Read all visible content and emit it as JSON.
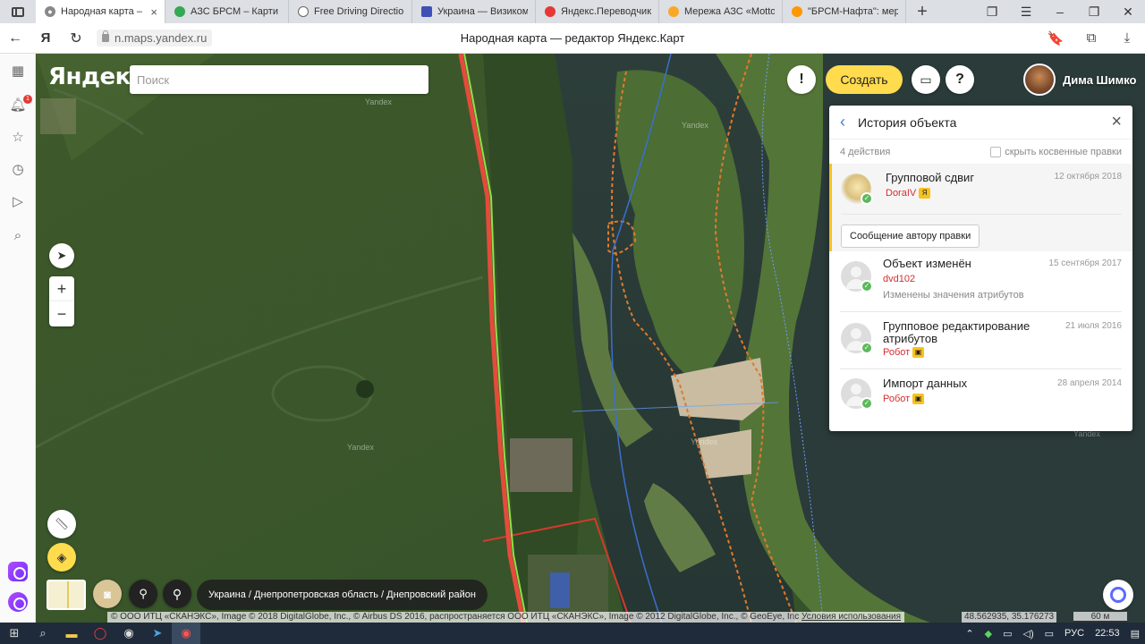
{
  "browser": {
    "tabs": [
      {
        "title": "Народная карта – ",
        "favicon_color": "#888888",
        "active": true
      },
      {
        "title": "АЗС БРСМ – Карти G",
        "favicon_color": "#34a853"
      },
      {
        "title": "Free Driving Directio",
        "favicon_color": "#666666"
      },
      {
        "title": "Украина — Визиком",
        "favicon_color": "#3f51b5"
      },
      {
        "title": "Яндекс.Переводчик",
        "favicon_color": "#e53935"
      },
      {
        "title": "Мережа АЗС «Motto",
        "favicon_color": "#f9a825"
      },
      {
        "title": "\"БРСМ-Нафта\": мере",
        "favicon_color": "#ff9800"
      }
    ],
    "address": "n.maps.yandex.ru",
    "page_title": "Народная карта — редактор Яндекс.Карт",
    "notification_count": "1"
  },
  "map": {
    "logo": "Яндекс",
    "search_placeholder": "Поиск",
    "alert_label": "!",
    "create_label": "Создать",
    "help_label": "?",
    "user_name": "Дима Шимко",
    "watermarks": [
      "Yandex",
      "Yandex",
      "Yandex",
      "Yandex",
      "Yandex"
    ],
    "address_path": "Украина / Днепропетровская область / Днепровский район",
    "attribution": "© ООО ИТЦ «СКАНЭКС», Image © 2018 DigitalGlobe, Inc., © Airbus DS 2016, распространяется ООО ИТЦ «СКАНЭКС», Image © 2012 DigitalGlobe, Inc., © GeoEye, Inc",
    "terms_link": "Условия использования",
    "coordinates": "48.562935, 35.176273",
    "scale": "60 м",
    "zoom_in": "+",
    "zoom_out": "−"
  },
  "history": {
    "title": "История объекта",
    "count": "4 действия",
    "hide_label": "скрыть косвенные правки",
    "message_button": "Сообщение автору правки",
    "entries": [
      {
        "title": "Групповой сдвиг",
        "date": "12 октября 2018",
        "author": "DoraIV",
        "badge": "Я"
      },
      {
        "title": "Объект изменён",
        "date": "15 сентября 2017",
        "author": "dvd102",
        "desc": "Изменены значения атрибутов"
      },
      {
        "title": "Групповое редактирование атрибутов",
        "date": "21 июля 2016",
        "author": "Робот"
      },
      {
        "title": "Импорт данных",
        "date": "28 апреля 2014",
        "author": "Робот"
      }
    ]
  },
  "taskbar": {
    "lang": "РУС",
    "time": "22:53"
  }
}
